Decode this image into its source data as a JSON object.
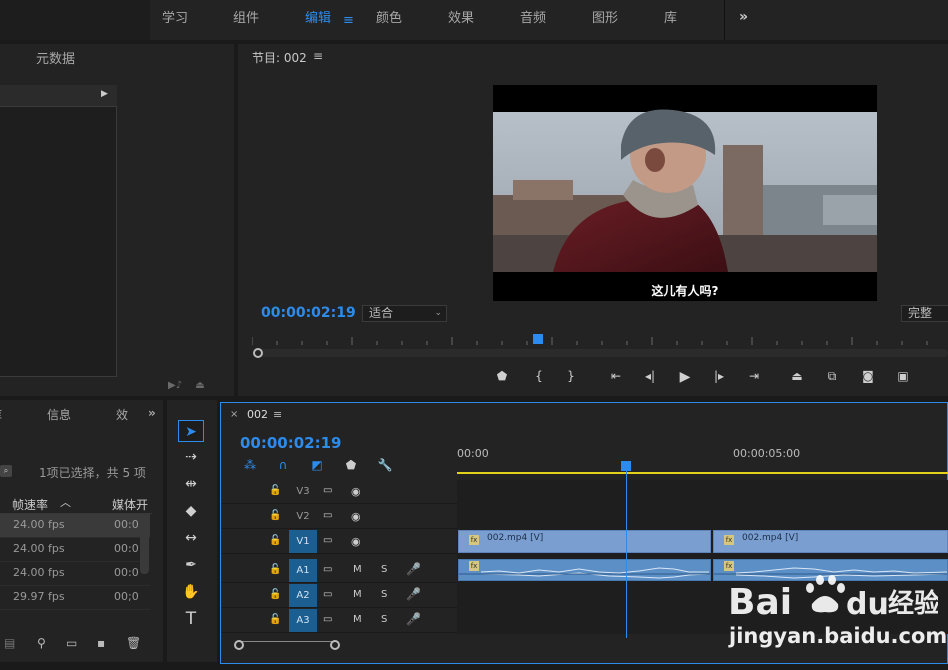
{
  "workspaces": {
    "tabs": [
      "学习",
      "组件",
      "编辑",
      "颜色",
      "效果",
      "音频",
      "图形",
      "库"
    ],
    "active": "编辑",
    "more": "»"
  },
  "metadata_panel": {
    "tab": "元数据"
  },
  "program_monitor": {
    "title": "节目: 002",
    "timecode": "00:00:02:19",
    "fit": "适合",
    "quality": "完整",
    "subtitle": "这儿有人吗?"
  },
  "project_panel": {
    "tabs": [
      "库",
      "信息",
      "效"
    ],
    "status": "1项已选择，共 5 项",
    "columns": [
      "帧速率",
      "媒体开"
    ],
    "rows": [
      {
        "fps": "24.00 fps",
        "media": "00:0",
        "selected": true
      },
      {
        "fps": "24.00 fps",
        "media": "00:0",
        "selected": false
      },
      {
        "fps": "24.00 fps",
        "media": "00:0",
        "selected": false
      },
      {
        "fps": "29.97 fps",
        "media": "00;0",
        "selected": false
      }
    ]
  },
  "timeline": {
    "sequence": "002",
    "timecode": "00:00:02:19",
    "ruler": [
      "00:00",
      "00:00:05:00"
    ],
    "tracks": [
      {
        "name": "V3",
        "type": "video",
        "targeted": false
      },
      {
        "name": "V2",
        "type": "video",
        "targeted": false
      },
      {
        "name": "V1",
        "type": "video",
        "targeted": true
      },
      {
        "name": "A1",
        "type": "audio",
        "targeted": true
      },
      {
        "name": "A2",
        "type": "audio",
        "targeted": true
      },
      {
        "name": "A3",
        "type": "audio",
        "targeted": true
      }
    ],
    "clips": [
      {
        "label": "002.mp4 [V]"
      },
      {
        "label": "002.mp4 [V]"
      }
    ],
    "mute": "M",
    "solo": "S"
  },
  "watermark": {
    "brand": "Bai du 经验",
    "url": "jingyan.baidu.com"
  },
  "colors": {
    "accent": "#2d8ceb",
    "video_clip": "#7a9ed0",
    "audio_clip": "#5b8fc6",
    "work_area": "#e3d21b"
  }
}
